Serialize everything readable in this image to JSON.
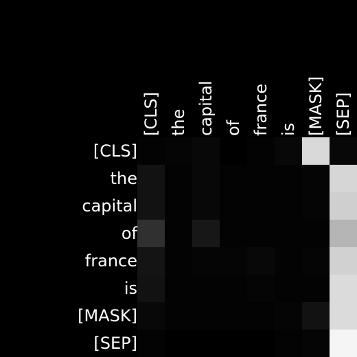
{
  "chart_data": {
    "type": "heatmap",
    "colormap": "grayscale",
    "background_color": "#000000",
    "text_color": "#ffffff",
    "x_tick_labels": [
      "[CLS]",
      "the",
      "capital",
      "of",
      "france",
      "is",
      "[MASK]",
      "[SEP]"
    ],
    "y_tick_labels": [
      "[CLS]",
      "the",
      "capital",
      "of",
      "france",
      "is",
      "[MASK]",
      "[SEP]"
    ],
    "x_tick_rotation": 90,
    "x_tick_position": "top",
    "value_range": [
      0,
      1
    ],
    "values": [
      [
        0.01,
        0.02,
        0.03,
        0.0,
        0.01,
        0.03,
        0.85,
        0.03
      ],
      [
        0.07,
        0.01,
        0.03,
        0.01,
        0.01,
        0.01,
        0.02,
        0.84
      ],
      [
        0.07,
        0.01,
        0.03,
        0.01,
        0.01,
        0.01,
        0.02,
        0.81
      ],
      [
        0.19,
        0.01,
        0.09,
        0.01,
        0.01,
        0.01,
        0.01,
        0.71
      ],
      [
        0.08,
        0.01,
        0.02,
        0.02,
        0.03,
        0.01,
        0.02,
        0.82
      ],
      [
        0.07,
        0.01,
        0.01,
        0.01,
        0.02,
        0.01,
        0.01,
        0.86
      ],
      [
        0.03,
        0.01,
        0.01,
        0.01,
        0.01,
        0.02,
        0.07,
        0.86
      ],
      [
        0.01,
        0.0,
        0.0,
        0.0,
        0.0,
        0.01,
        0.02,
        0.96
      ]
    ],
    "grid": false,
    "legend": "none",
    "title": "",
    "xlabel": "",
    "ylabel": ""
  }
}
